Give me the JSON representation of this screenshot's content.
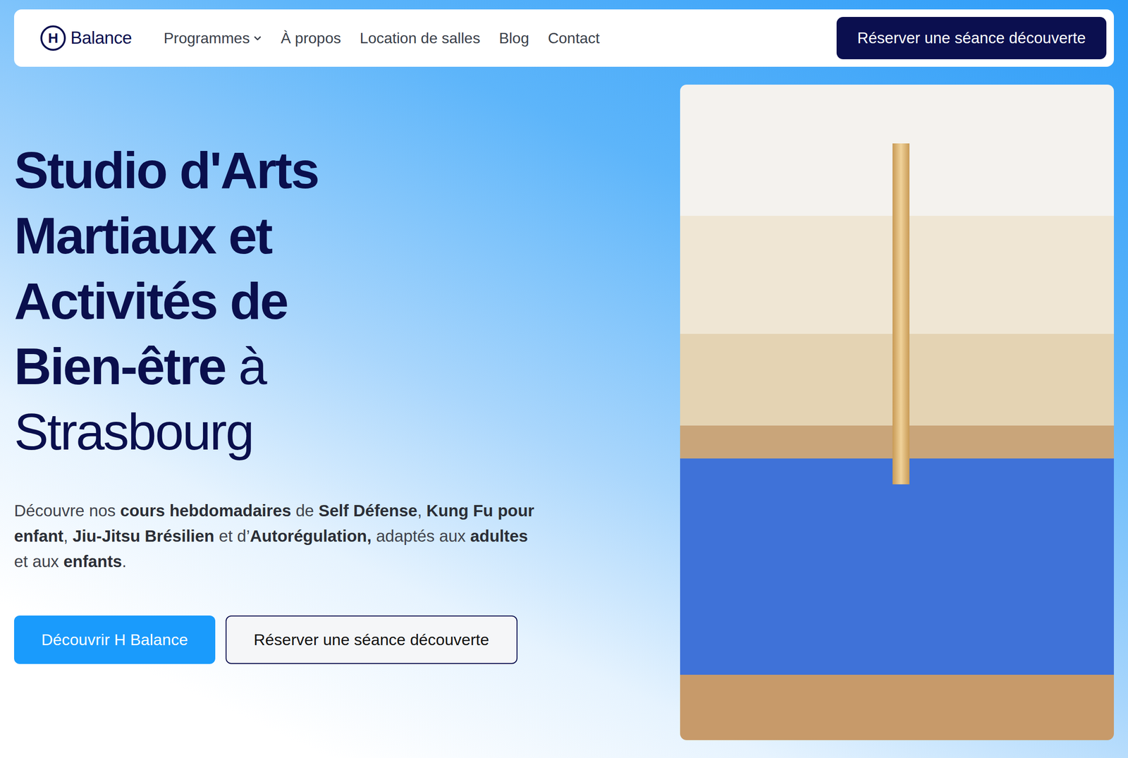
{
  "nav": {
    "logo": {
      "mark": "H",
      "text": "Balance"
    },
    "links": [
      {
        "label": "Programmes",
        "dropdown": true
      },
      {
        "label": "À propos",
        "dropdown": false
      },
      {
        "label": "Location de salles",
        "dropdown": false
      },
      {
        "label": "Blog",
        "dropdown": false
      },
      {
        "label": "Contact",
        "dropdown": false
      }
    ],
    "cta": "Réserver une séance découverte"
  },
  "hero": {
    "title": [
      [
        {
          "text": "Studio d'Arts",
          "strong": true
        }
      ],
      [
        {
          "text": "Martiaux et",
          "strong": true
        }
      ],
      [
        {
          "text": "Activités de",
          "strong": true
        }
      ],
      [
        {
          "text": "Bien-être",
          "strong": true
        },
        {
          "text": " à",
          "strong": false
        }
      ],
      [
        {
          "text": "Strasbourg",
          "strong": false
        }
      ]
    ],
    "intro": [
      {
        "text": "Découvre nos ",
        "strong": false
      },
      {
        "text": "cours hebdomadaires",
        "strong": true
      },
      {
        "text": " de ",
        "strong": false
      },
      {
        "text": "Self Défense",
        "strong": true
      },
      {
        "text": ", ",
        "strong": false
      },
      {
        "text": "Kung Fu pour enfant",
        "strong": true
      },
      {
        "text": ", ",
        "strong": false
      },
      {
        "text": "Jiu-Jitsu Brésilien",
        "strong": true
      },
      {
        "text": " et d’",
        "strong": false
      },
      {
        "text": "Autorégulation,",
        "strong": true
      },
      {
        "text": " adaptés aux ",
        "strong": false
      },
      {
        "text": "adultes",
        "strong": true
      },
      {
        "text": " et aux ",
        "strong": false
      },
      {
        "text": "enfants",
        "strong": true
      },
      {
        "text": ".",
        "strong": false
      }
    ],
    "buttons": [
      {
        "label": "Découvrir H Balance",
        "kind": "primary"
      },
      {
        "label": "Réserver une séance découverte",
        "kind": "outline"
      }
    ]
  }
}
